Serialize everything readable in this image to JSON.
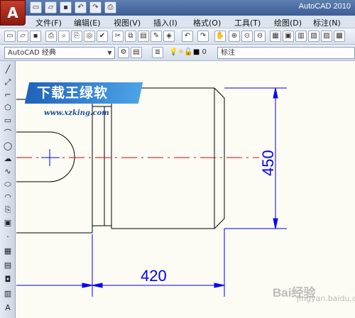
{
  "app": {
    "title": "AutoCAD 2010",
    "app_button_letter": "A"
  },
  "menu": {
    "items": [
      "文件(F)",
      "编辑(E)",
      "视图(V)",
      "插入(I)",
      "格式(O)",
      "工具(T)",
      "绘图(D)",
      "标注(N)"
    ]
  },
  "toolbar2": {
    "workspace": "AutoCAD 经典",
    "layer_value": "0",
    "style_label": "标注"
  },
  "drawing": {
    "dim_vertical": "450",
    "dim_horizontal": "420"
  },
  "watermark": {
    "logo_text": "下载王绿软",
    "url": "www.xzking.com",
    "baidu": "Bai经验",
    "baidu_sub": "jingyan.baidu.com"
  },
  "colors": {
    "dimension": "#0000ff",
    "centerline": "#e00000",
    "geometry": "#000000",
    "background": "#fcfcf4"
  }
}
